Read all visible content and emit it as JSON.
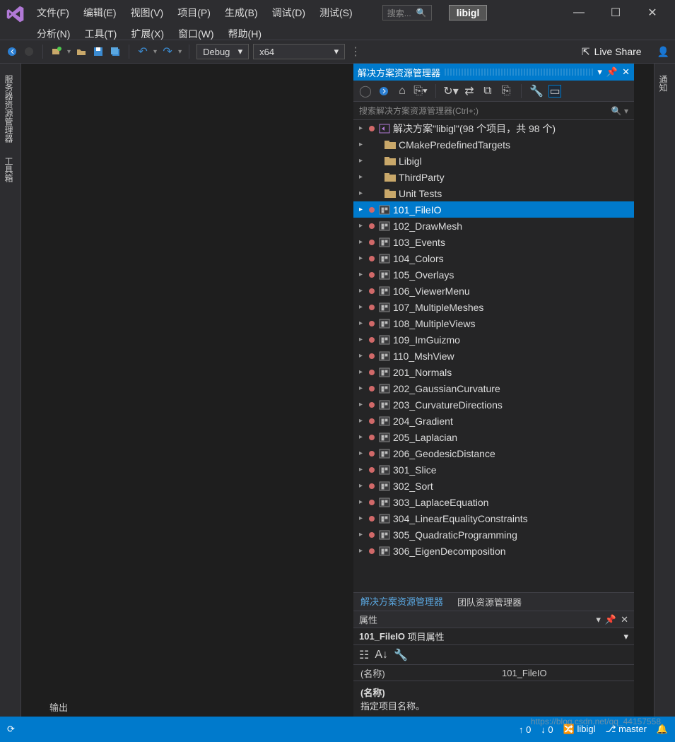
{
  "menu": {
    "row1": [
      "文件(F)",
      "编辑(E)",
      "视图(V)",
      "项目(P)",
      "生成(B)",
      "调试(D)",
      "测试(S)"
    ],
    "row2": [
      "分析(N)",
      "工具(T)",
      "扩展(X)",
      "窗口(W)",
      "帮助(H)"
    ]
  },
  "search_placeholder": "搜索...",
  "solution_short": "libigl",
  "toolbar": {
    "config": "Debug",
    "platform": "x64",
    "live_share": "Live Share"
  },
  "left_tabs": [
    "服务器资源管理器",
    "工具箱"
  ],
  "right_tabs": [
    "通知"
  ],
  "explorer": {
    "title": "解决方案资源管理器",
    "search_placeholder": "搜索解决方案资源管理器(Ctrl+;)",
    "solution_line": "解决方案\"libigl\"(98 个项目，共 98 个)",
    "folders": [
      "CMakePredefinedTargets",
      "Libigl",
      "ThirdParty",
      "Unit Tests"
    ],
    "projects": [
      "101_FileIO",
      "102_DrawMesh",
      "103_Events",
      "104_Colors",
      "105_Overlays",
      "106_ViewerMenu",
      "107_MultipleMeshes",
      "108_MultipleViews",
      "109_ImGuizmo",
      "110_MshView",
      "201_Normals",
      "202_GaussianCurvature",
      "203_CurvatureDirections",
      "204_Gradient",
      "205_Laplacian",
      "206_GeodesicDistance",
      "301_Slice",
      "302_Sort",
      "303_LaplaceEquation",
      "304_LinearEqualityConstraints",
      "305_QuadraticProgramming",
      "306_EigenDecomposition"
    ],
    "selected": "101_FileIO",
    "bottom_tabs": {
      "active": "解决方案资源管理器",
      "other": "团队资源管理器"
    }
  },
  "properties": {
    "title": "属性",
    "subtitle_left": "101_FileIO",
    "subtitle_right": "项目属性",
    "row_key": "(名称)",
    "row_val": "101_FileIO",
    "desc_head": "(名称)",
    "desc_body": "指定项目名称。"
  },
  "output_tab": "输出",
  "status": {
    "errors": "0",
    "warnings": "0",
    "repo": "libigl",
    "branch": "master"
  },
  "watermark": "https://blog.csdn.net/qq_44157558"
}
